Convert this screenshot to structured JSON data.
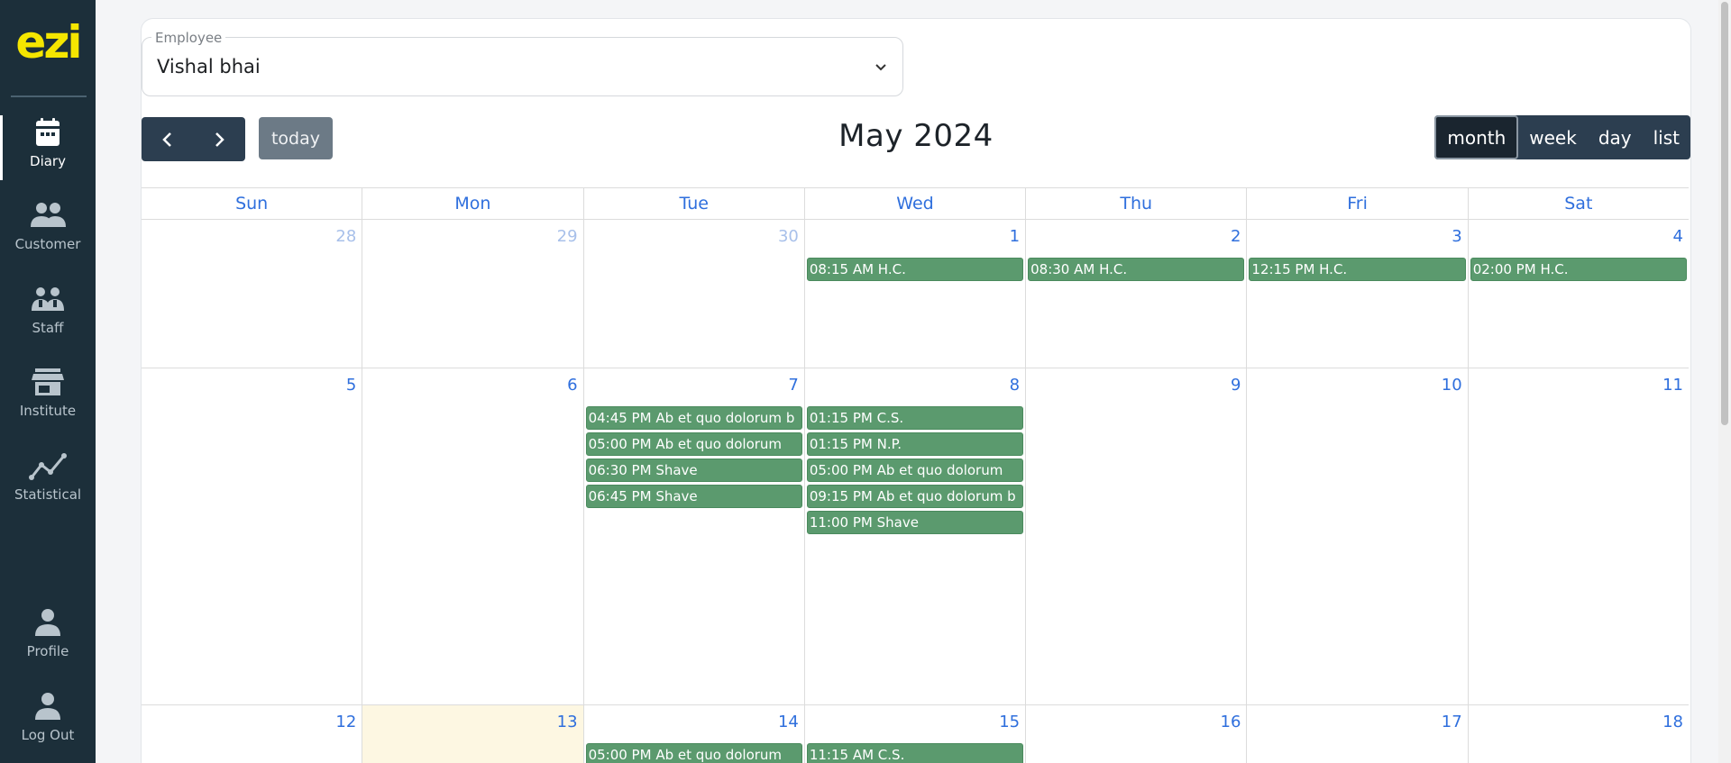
{
  "sidebar": {
    "logo": "ezi",
    "items": [
      {
        "label": "Diary",
        "icon": "calendar-icon"
      },
      {
        "label": "Customer",
        "icon": "group-icon"
      },
      {
        "label": "Staff",
        "icon": "staff-icon"
      },
      {
        "label": "Institute",
        "icon": "store-icon"
      },
      {
        "label": "Statistical",
        "icon": "chart-line-icon"
      },
      {
        "label": "Profile",
        "icon": "person-icon"
      },
      {
        "label": "Log Out",
        "icon": "person-icon"
      }
    ]
  },
  "employee": {
    "label": "Employee",
    "value": "Vishal bhai"
  },
  "toolbar": {
    "prev": "chevron-left-icon",
    "next": "chevron-right-icon",
    "today_label": "today",
    "title": "May 2024",
    "views": [
      "month",
      "week",
      "day",
      "list"
    ],
    "active_view": "month"
  },
  "calendar": {
    "weekdays": [
      "Sun",
      "Mon",
      "Tue",
      "Wed",
      "Thu",
      "Fri",
      "Sat"
    ],
    "weeks": [
      {
        "days": [
          {
            "num": "28",
            "other": true,
            "events": []
          },
          {
            "num": "29",
            "other": true,
            "events": []
          },
          {
            "num": "30",
            "other": true,
            "events": []
          },
          {
            "num": "1",
            "events": [
              "08:15 AM H.C."
            ]
          },
          {
            "num": "2",
            "events": [
              "08:30 AM H.C."
            ]
          },
          {
            "num": "3",
            "events": [
              "12:15 PM H.C."
            ]
          },
          {
            "num": "4",
            "events": [
              "02:00 PM H.C."
            ]
          }
        ]
      },
      {
        "days": [
          {
            "num": "5",
            "events": []
          },
          {
            "num": "6",
            "events": []
          },
          {
            "num": "7",
            "events": [
              "04:45 PM Ab et quo dolorum b",
              "05:00 PM Ab et quo dolorum",
              "06:30 PM Shave",
              "06:45 PM Shave"
            ]
          },
          {
            "num": "8",
            "events": [
              "01:15 PM C.S.",
              "01:15 PM N.P.",
              "05:00 PM Ab et quo dolorum",
              "09:15 PM Ab et quo dolorum b",
              "11:00 PM Shave"
            ]
          },
          {
            "num": "9",
            "events": []
          },
          {
            "num": "10",
            "events": []
          },
          {
            "num": "11",
            "events": []
          }
        ]
      },
      {
        "days": [
          {
            "num": "12",
            "events": []
          },
          {
            "num": "13",
            "today": true,
            "events": []
          },
          {
            "num": "14",
            "events": [
              "05:00 PM Ab et quo dolorum"
            ]
          },
          {
            "num": "15",
            "events": [
              "11:15 AM C.S."
            ]
          },
          {
            "num": "16",
            "events": []
          },
          {
            "num": "17",
            "events": []
          },
          {
            "num": "18",
            "events": []
          }
        ]
      }
    ]
  },
  "colors": {
    "sidebar_bg": "#1c2f3a",
    "logo": "#f5e600",
    "toolbar_btn": "#2c3e50",
    "event_bg": "#5b9a6e",
    "day_link": "#2f6fdd",
    "today_bg": "#fdf7e2"
  }
}
